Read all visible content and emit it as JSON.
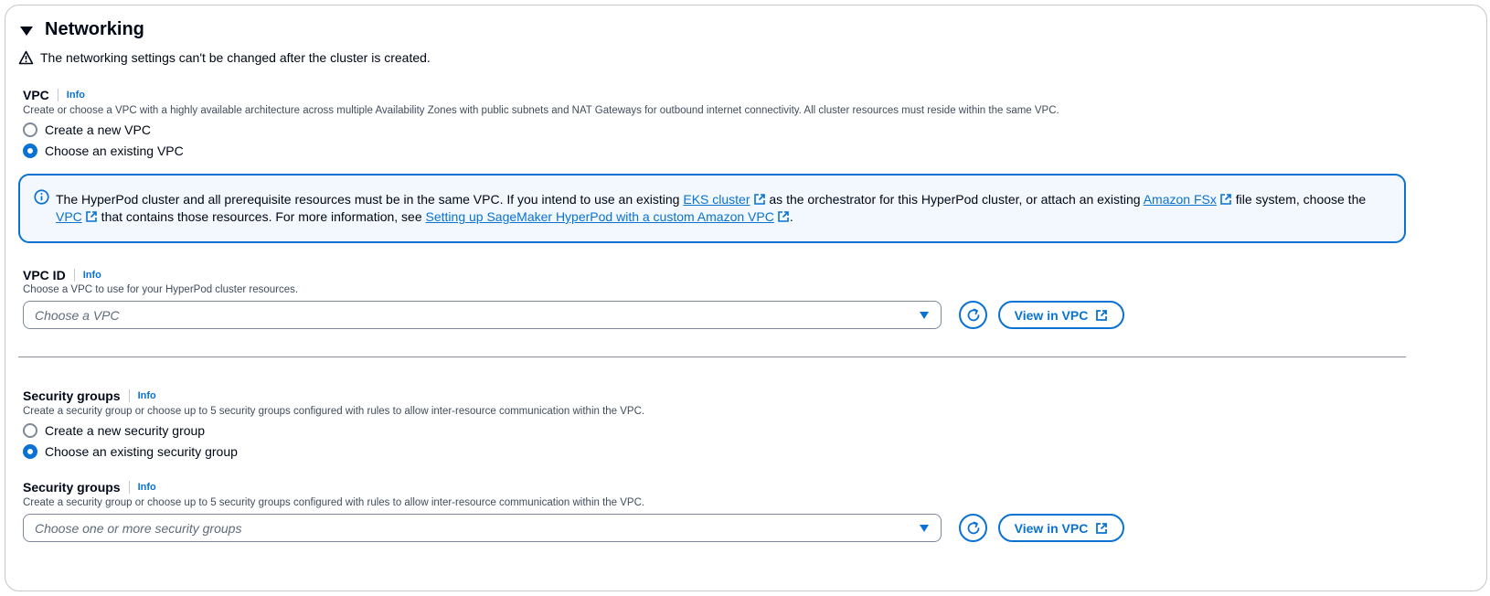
{
  "section": {
    "title": "Networking",
    "warning": "The networking settings can't be changed after the cluster is created."
  },
  "vpc": {
    "label": "VPC",
    "info": "Info",
    "description": "Create or choose a VPC with a highly available architecture across multiple Availability Zones with public subnets and NAT Gateways for outbound internet connectivity. All cluster resources must reside within the same VPC.",
    "options": [
      {
        "label": "Create a new VPC",
        "selected": false
      },
      {
        "label": "Choose an existing VPC",
        "selected": true
      }
    ]
  },
  "alert": {
    "t1": "The HyperPod cluster and all prerequisite resources must be in the same VPC. If you intend to use an existing ",
    "link1": "EKS cluster",
    "t2": " as the orchestrator for this HyperPod cluster, or attach an existing ",
    "link2": "Amazon FSx",
    "t3": " file system, choose the ",
    "link3": "VPC",
    "t4": " that contains those resources. For more information, see ",
    "link4": "Setting up SageMaker HyperPod with a custom Amazon VPC",
    "t5": "."
  },
  "vpc_id": {
    "label": "VPC ID",
    "info": "Info",
    "description": "Choose a VPC to use for your HyperPod cluster resources.",
    "placeholder": "Choose a VPC",
    "view_button": "View in VPC"
  },
  "security_groups": {
    "label": "Security groups",
    "info": "Info",
    "description": "Create a security group or choose up to 5 security groups configured with rules to allow inter-resource communication within the VPC.",
    "options": [
      {
        "label": "Create a new security group",
        "selected": false
      },
      {
        "label": "Choose an existing security group",
        "selected": true
      }
    ]
  },
  "security_groups_select": {
    "label": "Security groups",
    "info": "Info",
    "description": "Create a security group or choose up to 5 security groups configured with rules to allow inter-resource communication within the VPC.",
    "placeholder": "Choose one or more security groups",
    "view_button": "View in VPC"
  },
  "colors": {
    "accent": "#0972d3",
    "alert_bg": "#f2f8fd",
    "text": "#000716",
    "secondary_text": "#414d5c"
  }
}
